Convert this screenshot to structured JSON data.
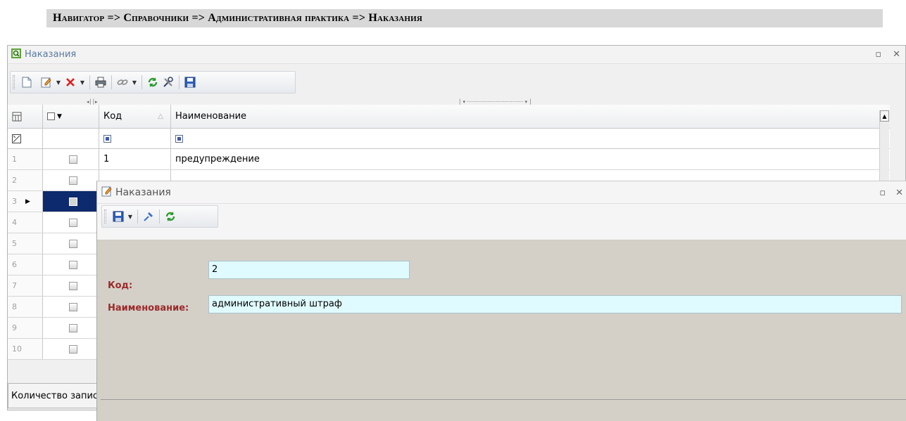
{
  "breadcrumb": {
    "text": "Навигатор => Справочники => Административная практика => Наказания"
  },
  "main_window": {
    "title": "Наказания",
    "toolbar": {
      "icons": [
        "new-doc-icon",
        "edit-icon",
        "delete-icon",
        "print-icon",
        "link-icon",
        "refresh-icon",
        "settings-icon",
        "save-icon"
      ]
    },
    "grid": {
      "columns": {
        "code": "Код",
        "name": "Наименование"
      },
      "rows": [
        {
          "num": "1",
          "code": "1",
          "name": "предупреждение",
          "selected": false
        },
        {
          "num": "2",
          "code": "",
          "name": "",
          "selected": false
        },
        {
          "num": "3",
          "code": "",
          "name": "",
          "selected": true
        },
        {
          "num": "4",
          "code": "",
          "name": "",
          "selected": false
        },
        {
          "num": "5",
          "code": "",
          "name": "",
          "selected": false
        },
        {
          "num": "6",
          "code": "",
          "name": "",
          "selected": false
        },
        {
          "num": "7",
          "code": "",
          "name": "",
          "selected": false
        },
        {
          "num": "8",
          "code": "",
          "name": "",
          "selected": false
        },
        {
          "num": "9",
          "code": "",
          "name": "",
          "selected": false
        },
        {
          "num": "10",
          "code": "",
          "name": "",
          "selected": false
        }
      ]
    },
    "status": "Количество записей"
  },
  "dialog": {
    "title": "Наказания",
    "fields": {
      "code_label": "Код:",
      "code_value": "2",
      "name_label": "Наименование:",
      "name_value": "административный штраф"
    }
  },
  "colors": {
    "accent": "#0c2a6d",
    "label": "#9b2a2a",
    "input_bg": "#e0fbff"
  }
}
